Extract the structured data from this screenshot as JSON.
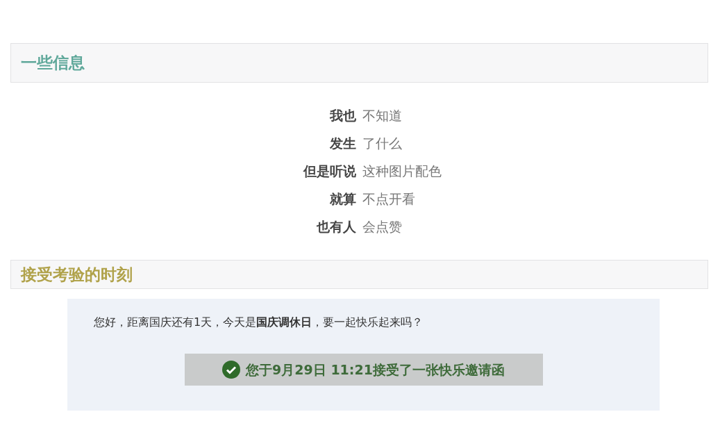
{
  "sections": [
    {
      "title": "一些信息",
      "color": "#5fa89a"
    },
    {
      "title": "接受考验的时刻",
      "color": "#b0a24a"
    }
  ],
  "info_rows": [
    {
      "label": "我也",
      "value": "不知道"
    },
    {
      "label": "发生",
      "value": "了什么"
    },
    {
      "label": "但是听说",
      "value": "这种图片配色"
    },
    {
      "label": "就算",
      "value": "不点开看"
    },
    {
      "label": "也有人",
      "value": "会点赞"
    }
  ],
  "notice": {
    "message": "您好，距离国庆还有1天，今天是**国庆调休日**，要一起快乐起来吗？",
    "status": "您于9月29日 11:21接受了一张快乐邀请函",
    "accepted": true
  }
}
